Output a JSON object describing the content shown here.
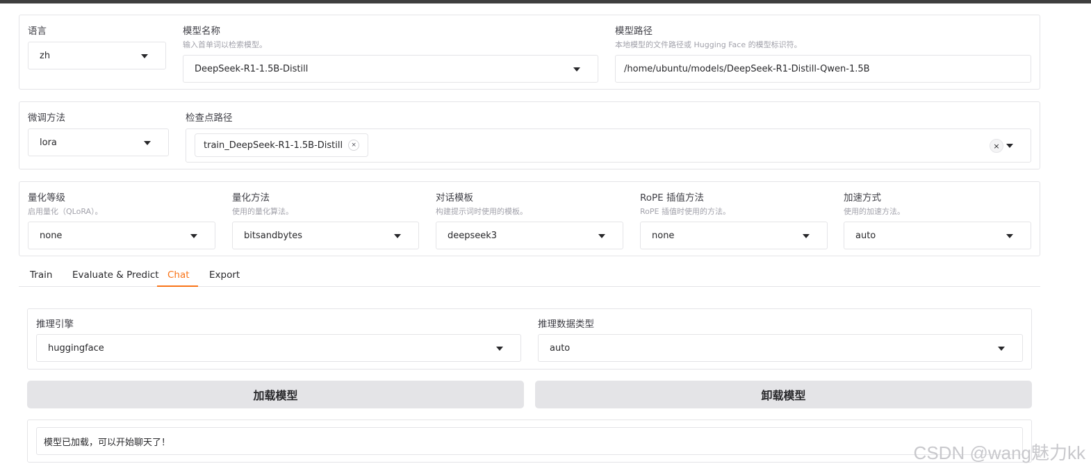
{
  "top_row": {
    "language": {
      "label": "语言",
      "value": "zh"
    },
    "model_name": {
      "label": "模型名称",
      "info": "输入首单词以检索模型。",
      "value": "DeepSeek-R1-1.5B-Distill"
    },
    "model_path": {
      "label": "模型路径",
      "info": "本地模型的文件路径或 Hugging Face 的模型标识符。",
      "value": "/home/ubuntu/models/DeepSeek-R1-Distill-Qwen-1.5B"
    }
  },
  "second_row": {
    "finetune": {
      "label": "微调方法",
      "value": "lora"
    },
    "checkpoint": {
      "label": "检查点路径",
      "chips": [
        "train_DeepSeek-R1-1.5B-Distill"
      ],
      "chip_remove": "×",
      "clear": "×"
    }
  },
  "third_row": {
    "quant_bit": {
      "label": "量化等级",
      "info": "启用量化（QLoRA）。",
      "value": "none"
    },
    "quant_method": {
      "label": "量化方法",
      "info": "使用的量化算法。",
      "value": "bitsandbytes"
    },
    "template": {
      "label": "对话模板",
      "info": "构建提示词时使用的模板。",
      "value": "deepseek3"
    },
    "rope": {
      "label": "RoPE 插值方法",
      "info": "RoPE 插值时使用的方法。",
      "value": "none"
    },
    "booster": {
      "label": "加速方式",
      "info": "使用的加速方法。",
      "value": "auto"
    }
  },
  "tabs": [
    {
      "label": "Train"
    },
    {
      "label": "Evaluate & Predict"
    },
    {
      "label": "Chat"
    },
    {
      "label": "Export"
    }
  ],
  "chat": {
    "infer_backend": {
      "label": "推理引擎",
      "value": "huggingface"
    },
    "infer_dtype": {
      "label": "推理数据类型",
      "value": "auto"
    },
    "load_button": "加载模型",
    "unload_button": "卸载模型",
    "info_box": "模型已加载，可以开始聊天了！"
  },
  "watermark": "CSDN @wang魅力kk",
  "colors": {
    "accent": "#f97316",
    "button_bg": "#e4e4e7",
    "border": "#e4e4e7"
  }
}
